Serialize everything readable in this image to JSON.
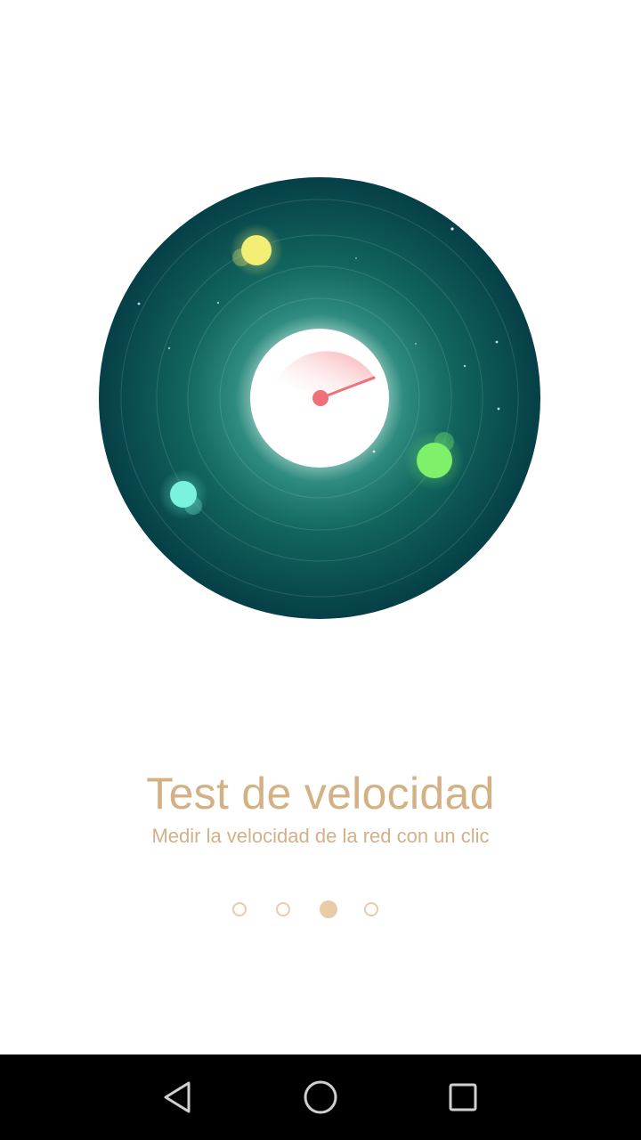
{
  "onboarding": {
    "title": "Test de velocidad",
    "subtitle": "Medir la velocidad de la red con un clic",
    "page_count": 4,
    "active_page": 3
  },
  "illustration": {
    "icon": "speedometer-icon",
    "disc_color": "#0f5f5a",
    "dial_fill_color": "#f7a3a6",
    "needle_color": "#f07078",
    "orbs": [
      {
        "name": "yellow-orb",
        "color": "#f3ee74"
      },
      {
        "name": "green-orb",
        "color": "#7ef06a"
      },
      {
        "name": "cyan-orb",
        "color": "#79f3dd"
      }
    ]
  },
  "navbar": {
    "back": "back-triangle-icon",
    "home": "home-circle-icon",
    "recents": "recents-square-icon"
  },
  "colors": {
    "accent": "#d4b184",
    "dot": "#e9cba8"
  }
}
